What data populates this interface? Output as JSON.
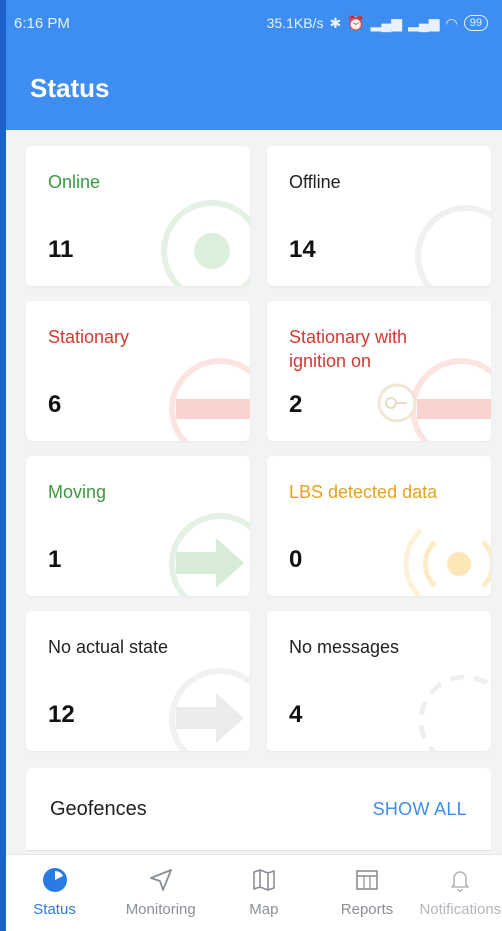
{
  "statusbar": {
    "time": "6:16 PM",
    "network_speed": "35.1KB/s",
    "icons": [
      "bluetooth-icon",
      "alarm-icon",
      "signal-icon",
      "signal-icon",
      "wifi-icon"
    ],
    "battery": "99"
  },
  "header": {
    "title": "Status"
  },
  "cards": [
    {
      "label": "Online",
      "count": "11",
      "color": "#3a9a3f",
      "icon": "online-circle-icon"
    },
    {
      "label": "Offline",
      "count": "14",
      "color": "#222222",
      "icon": "offline-circle-icon"
    },
    {
      "label": "Stationary",
      "count": "6",
      "color": "#d23a2f",
      "icon": "stop-icon"
    },
    {
      "label": "Stationary with ignition on",
      "count": "2",
      "color": "#d23a2f",
      "icon": "key-stop-icon"
    },
    {
      "label": "Moving",
      "count": "1",
      "color": "#3a9a3f",
      "icon": "arrow-right-icon"
    },
    {
      "label": "LBS detected data",
      "count": "0",
      "color": "#e6a21c",
      "icon": "lbs-signal-icon"
    },
    {
      "label": "No actual state",
      "count": "12",
      "color": "#222222",
      "icon": "gray-arrow-icon"
    },
    {
      "label": "No messages",
      "count": "4",
      "color": "#222222",
      "icon": "dashed-circle-icon"
    }
  ],
  "geofences": {
    "title": "Geofences",
    "action": "SHOW ALL"
  },
  "bottom_nav": [
    {
      "label": "Status",
      "icon": "status-pie-icon",
      "active": true
    },
    {
      "label": "Monitoring",
      "icon": "navigation-arrow-icon",
      "active": false
    },
    {
      "label": "Map",
      "icon": "map-icon",
      "active": false
    },
    {
      "label": "Reports",
      "icon": "reports-icon",
      "active": false
    },
    {
      "label": "Notifications",
      "icon": "bell-icon",
      "active": false
    }
  ],
  "colors": {
    "primary": "#3d8ef0",
    "background": "#f2f3f5"
  }
}
